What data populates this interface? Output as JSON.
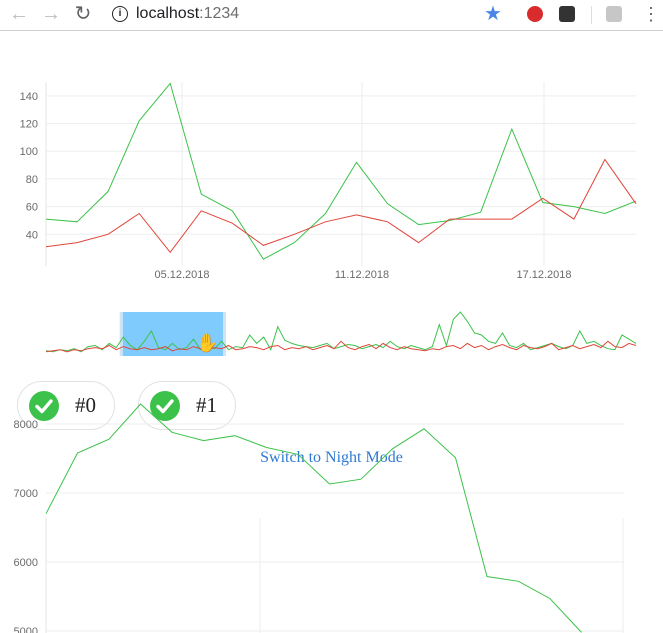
{
  "browser": {
    "url_host": "localhost",
    "url_port": ":1234"
  },
  "colors": {
    "green": "#3cc24a",
    "red": "#e0453a",
    "brush": "#7fcbfd",
    "link": "#2e7ad1"
  },
  "toggles": [
    {
      "label": "#0"
    },
    {
      "label": "#1"
    }
  ],
  "night_mode_label": "Switch to Night Mode",
  "chart_data": [
    {
      "type": "line",
      "x_tick_labels": [
        "05.12.2018",
        "11.12.2018",
        "17.12.2018"
      ],
      "y_tick_labels": [
        "40",
        "60",
        "80",
        "100",
        "120",
        "140"
      ],
      "ylim": [
        20,
        150
      ],
      "grid": true,
      "series": [
        {
          "color": "#3cc24a",
          "values": [
            51,
            49,
            71,
            122,
            149,
            69,
            57,
            22,
            34,
            55,
            92,
            62,
            47,
            50,
            56,
            116,
            63,
            60,
            55,
            64
          ]
        },
        {
          "color": "#e0453a",
          "values": [
            31,
            34,
            40,
            55,
            27,
            57,
            48,
            32,
            40,
            49,
            54,
            49,
            34,
            51,
            51,
            51,
            66,
            51,
            94,
            62
          ]
        }
      ]
    },
    {
      "type": "line",
      "role": "overview-brush",
      "brush": [
        0.13,
        0.3
      ],
      "series": [
        {
          "color": "#3cc24a",
          "values": [
            5,
            4,
            6,
            5,
            7,
            4,
            9,
            10,
            6,
            12,
            8,
            18,
            10,
            6,
            14,
            24,
            8,
            6,
            12,
            6,
            8,
            16,
            6,
            10,
            7,
            14,
            6,
            9,
            8,
            20,
            12,
            18,
            6,
            28,
            15,
            12,
            10,
            9,
            8,
            10,
            12,
            7,
            9,
            11,
            10,
            7,
            9,
            11,
            8,
            14,
            9,
            7,
            10,
            8,
            6,
            9,
            30,
            10,
            35,
            42,
            33,
            22,
            20,
            14,
            12,
            22,
            10,
            8,
            12,
            6,
            8,
            10,
            12,
            9,
            7,
            10,
            24,
            12,
            14,
            10,
            7,
            6,
            20,
            16,
            12
          ]
        },
        {
          "color": "#e0453a",
          "values": [
            4,
            5,
            6,
            4,
            6,
            5,
            7,
            8,
            7,
            10,
            6,
            9,
            7,
            6,
            8,
            6,
            7,
            9,
            5,
            7,
            6,
            9,
            7,
            6,
            8,
            7,
            10,
            6,
            7,
            9,
            8,
            6,
            9,
            10,
            6,
            8,
            7,
            9,
            6,
            8,
            10,
            7,
            14,
            8,
            6,
            9,
            11,
            7,
            12,
            8,
            6,
            9,
            7,
            6,
            5,
            7,
            6,
            9,
            10,
            7,
            12,
            8,
            10,
            6,
            9,
            11,
            8,
            6,
            10,
            8,
            7,
            9,
            12,
            6,
            8,
            10,
            7,
            9,
            11,
            8,
            14,
            9,
            8,
            12,
            10
          ]
        }
      ]
    },
    {
      "type": "line",
      "y_tick_labels": [
        "5000",
        "6000",
        "7000",
        "8000"
      ],
      "ylim": [
        5000,
        8300
      ],
      "grid": true,
      "series": [
        {
          "color": "#3cc24a",
          "values": [
            6700,
            7580,
            7780,
            8290,
            7880,
            7760,
            7830,
            7660,
            7560,
            7130,
            7200,
            7640,
            7930,
            7510,
            5790,
            5720,
            5470,
            4980
          ]
        }
      ]
    }
  ]
}
